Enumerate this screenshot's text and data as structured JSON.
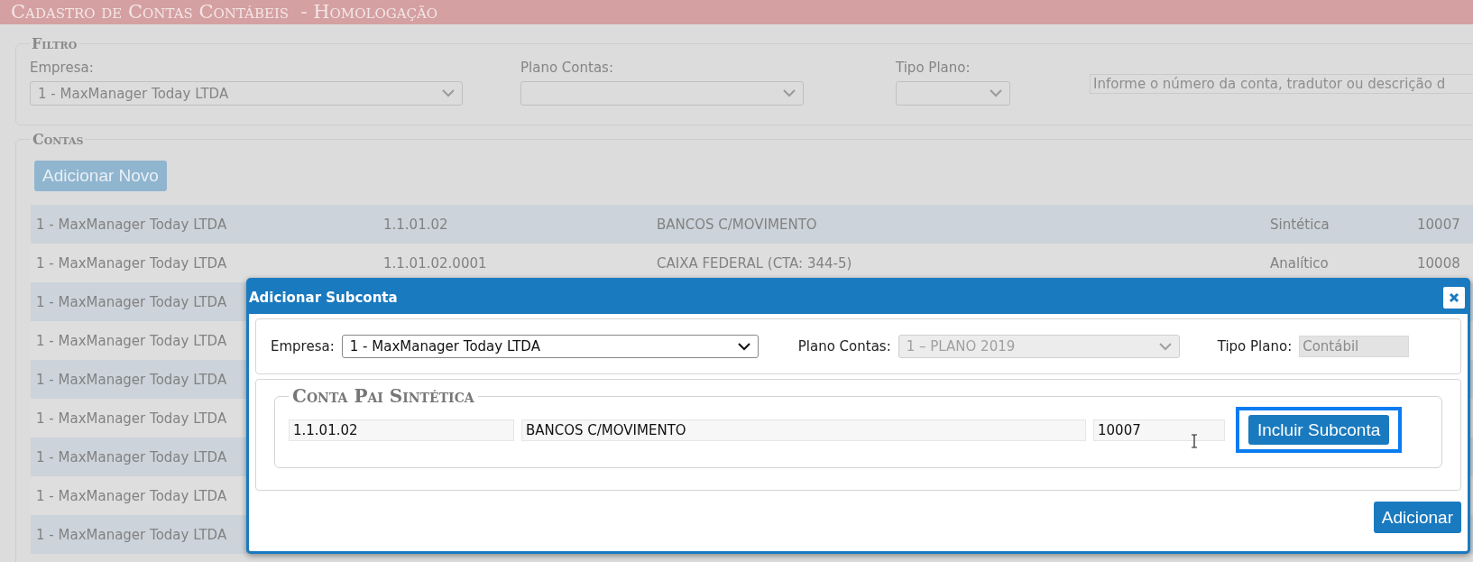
{
  "header": {
    "title": "Cadastro de Contas Contábeis  - Homologação"
  },
  "filter": {
    "legend": "Filtro",
    "company": {
      "label": "Empresa:",
      "value": "1 - MaxManager Today LTDA"
    },
    "chart_of_accounts": {
      "label": "Plano Contas:"
    },
    "plan_type": {
      "label": "Tipo Plano:"
    },
    "search": {
      "placeholder": "Informe o número da conta, tradutor ou descrição d"
    }
  },
  "accounts": {
    "legend": "Contas",
    "add_button": "Adicionar Novo",
    "rows": [
      {
        "cells": [
          "1 - MaxManager Today LTDA",
          "1.1.01.02",
          "BANCOS C/MOVIMENTO",
          "Sintética",
          "10007"
        ]
      },
      {
        "cells": [
          "1 - MaxManager Today LTDA",
          "1.1.01.02.0001",
          "CAIXA FEDERAL (CTA: 344-5)",
          "Analítico",
          "10008"
        ]
      },
      {
        "cells": [
          "1 - MaxManager Today LTDA"
        ]
      },
      {
        "cells": [
          "1 - MaxManager Today LTDA"
        ]
      },
      {
        "cells": [
          "1 - MaxManager Today LTDA"
        ]
      },
      {
        "cells": [
          "1 - MaxManager Today LTDA"
        ]
      },
      {
        "cells": [
          "1 - MaxManager Today LTDA"
        ]
      },
      {
        "cells": [
          "1 - MaxManager Today LTDA"
        ]
      },
      {
        "cells": [
          "1 - MaxManager Today LTDA"
        ]
      }
    ]
  },
  "dialog": {
    "title": "Adicionar Subconta",
    "company": {
      "label": "Empresa:",
      "value": "1 - MaxManager Today LTDA",
      "disabled": false
    },
    "chart_of_accounts": {
      "label": "Plano Contas:",
      "value": "1 – PLANO 2019",
      "disabled": true
    },
    "plan_type": {
      "label": "Tipo Plano:",
      "value": "Contábil",
      "disabled": true
    },
    "parent": {
      "legend": "Conta Pai Sintética",
      "code": "1.1.01.02",
      "description": "BANCOS C/MOVIMENTO",
      "number": "10007"
    },
    "include_button": {
      "label": "Incluir Subconta",
      "focused": true
    },
    "add_button": "Adicionar"
  }
}
